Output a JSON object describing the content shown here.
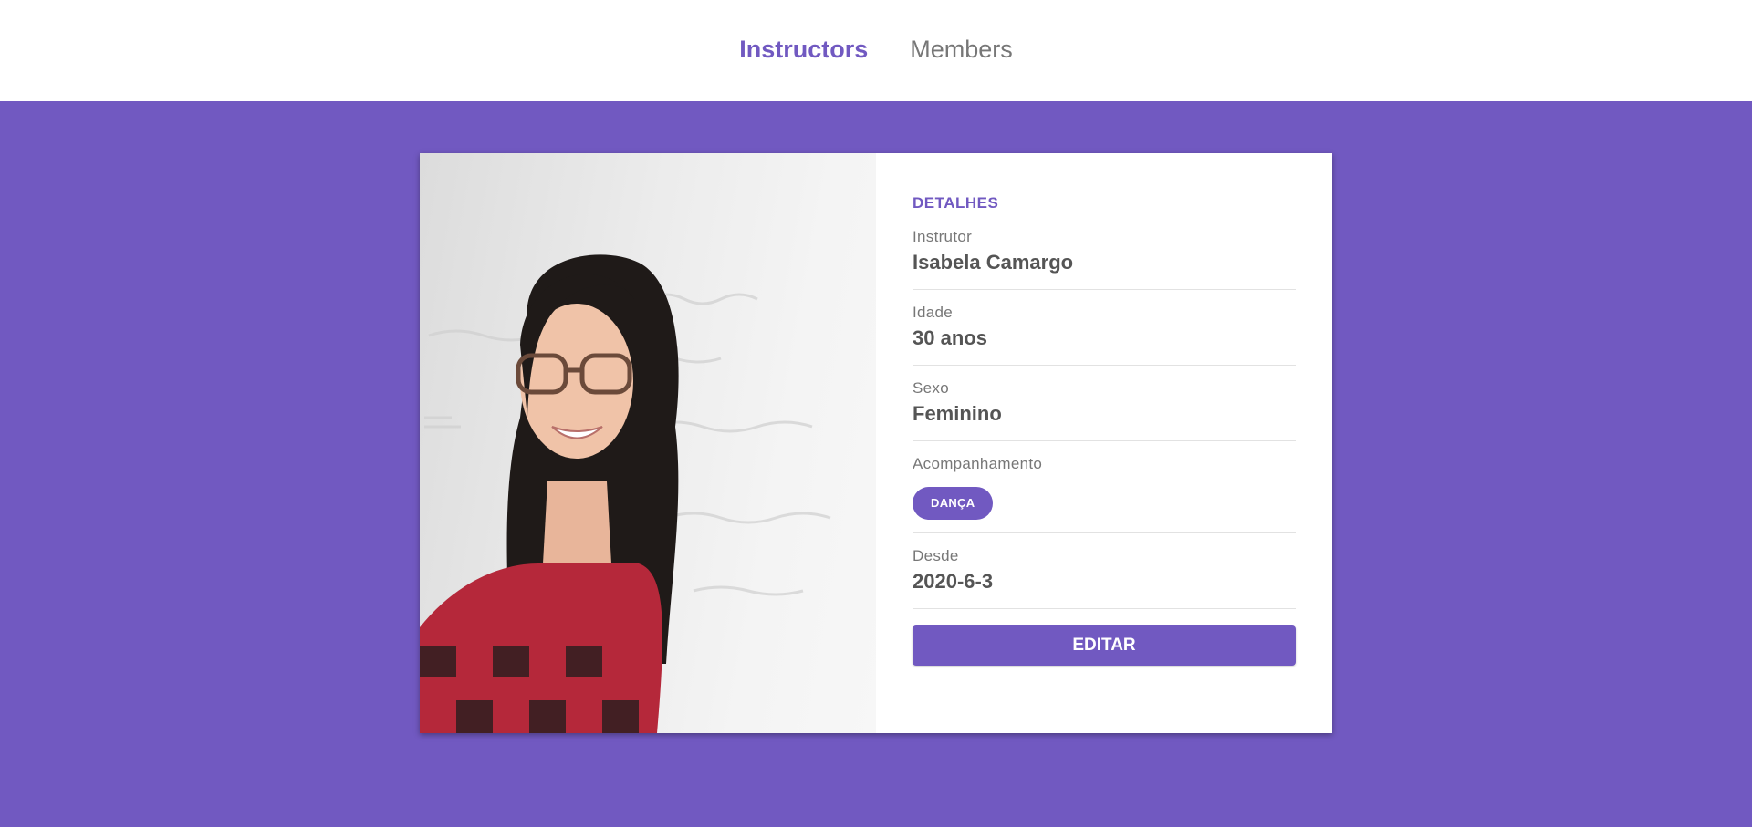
{
  "nav": {
    "items": [
      {
        "label": "Instructors",
        "active": true
      },
      {
        "label": "Members",
        "active": false
      }
    ]
  },
  "colors": {
    "accent": "#7159c1",
    "text": "#555555",
    "muted": "#777777"
  },
  "details": {
    "section_title": "DETALHES",
    "instructor": {
      "label": "Instrutor",
      "value": "Isabela Camargo"
    },
    "age": {
      "label": "Idade",
      "value": "30 anos"
    },
    "gender": {
      "label": "Sexo",
      "value": "Feminino"
    },
    "tracking": {
      "label": "Acompanhamento",
      "chips": [
        "DANÇA"
      ]
    },
    "since": {
      "label": "Desde",
      "value": "2020-6-3"
    },
    "edit_label": "EDITAR"
  },
  "photo": {
    "icon": "instructor-photo"
  }
}
